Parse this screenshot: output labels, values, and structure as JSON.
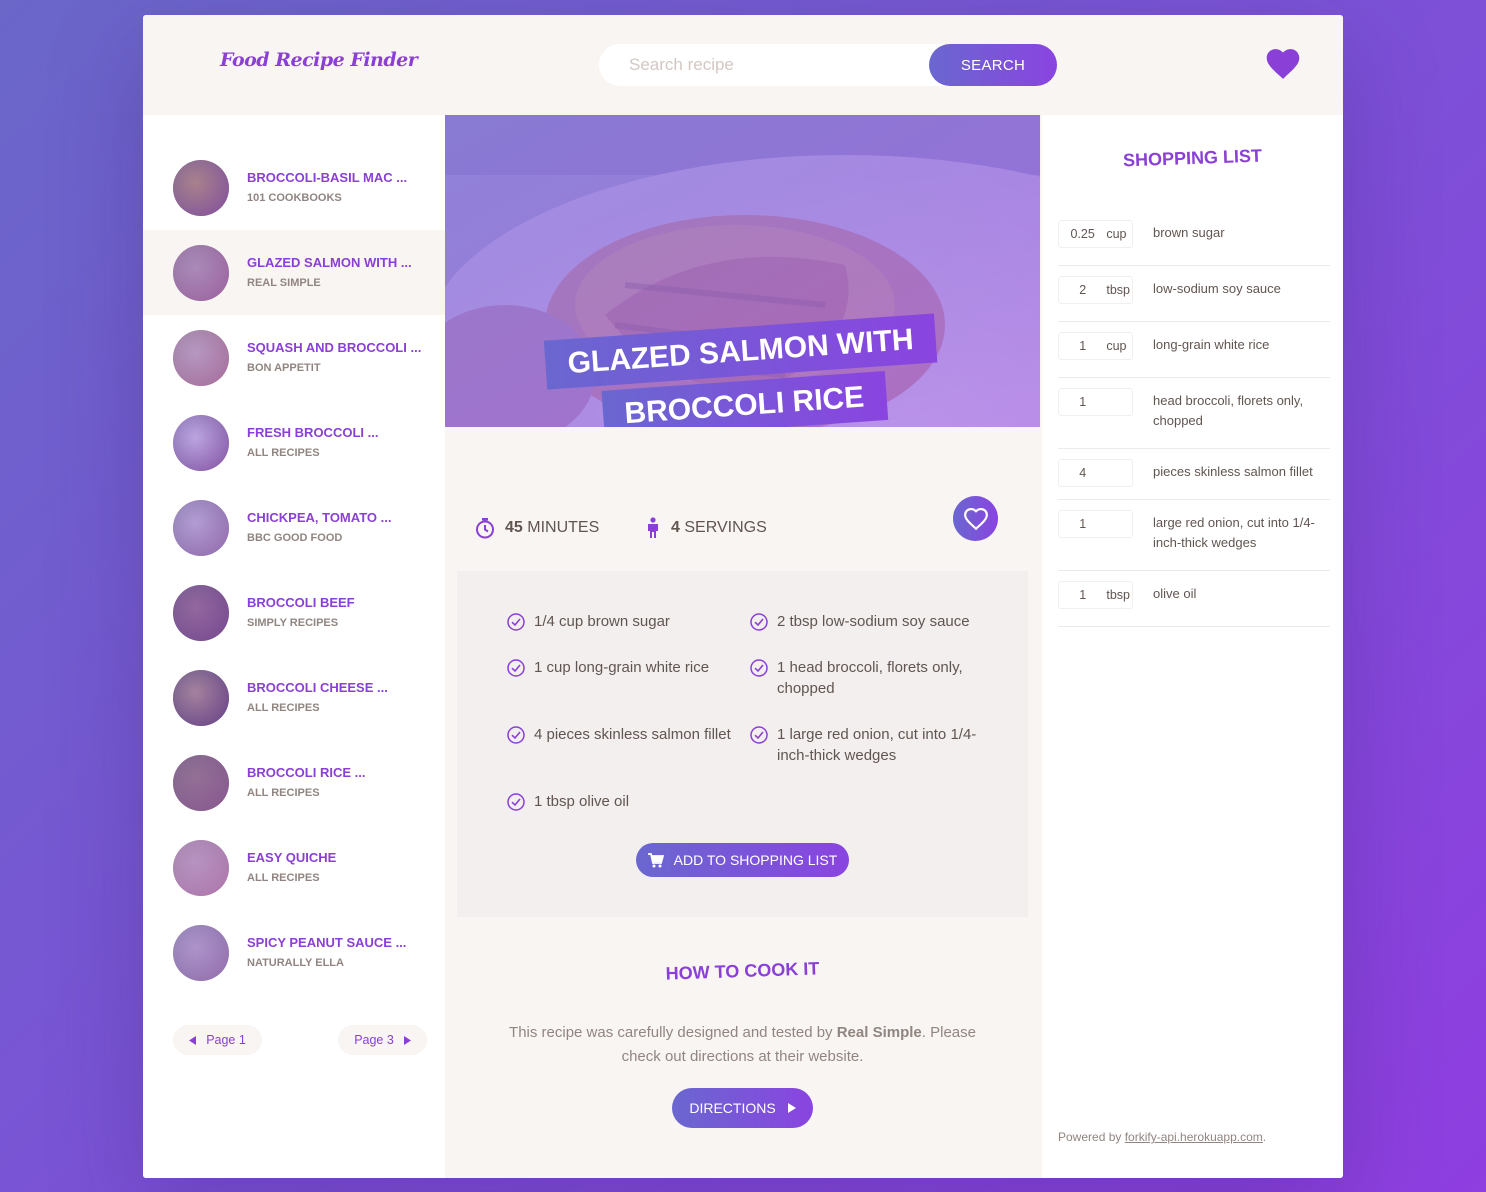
{
  "app": {
    "logo": "Food Recipe Finder"
  },
  "search": {
    "placeholder": "Search recipe",
    "button_label": "SEARCH"
  },
  "colors": {
    "accent": "#8a3fd6",
    "gradient_start": "#6a67d0",
    "gradient_end": "#8a44e0",
    "text": "#615551",
    "muted": "#918581",
    "panel": "#f9f5f3"
  },
  "results": [
    {
      "title": "Broccoli-Basil Mac ...",
      "author": "101 Cookbooks"
    },
    {
      "title": "Glazed Salmon with ...",
      "author": "Real Simple"
    },
    {
      "title": "Squash and Broccoli ...",
      "author": "Bon Appetit"
    },
    {
      "title": "Fresh Broccoli ...",
      "author": "All Recipes"
    },
    {
      "title": "Chickpea, Tomato ...",
      "author": "BBC Good Food"
    },
    {
      "title": "Broccoli Beef",
      "author": "Simply Recipes"
    },
    {
      "title": "Broccoli Cheese ...",
      "author": "All Recipes"
    },
    {
      "title": "Broccoli Rice ...",
      "author": "All Recipes"
    },
    {
      "title": "Easy Quiche",
      "author": "All Recipes"
    },
    {
      "title": "Spicy Peanut Sauce ...",
      "author": "Naturally Ella"
    }
  ],
  "pagination": {
    "prev_label": "Page 1",
    "next_label": "Page 3"
  },
  "recipe": {
    "title_line1": "Glazed Salmon with",
    "title_line2": "Broccoli Rice",
    "minutes": "45",
    "minutes_label": "minutes",
    "servings": "4",
    "servings_label": "servings",
    "ingredients": [
      {
        "text": "1/4 cup brown sugar"
      },
      {
        "text": "2 tbsp low-sodium soy sauce"
      },
      {
        "text": "1 cup long-grain white rice"
      },
      {
        "text": "1 head broccoli, florets only, chopped"
      },
      {
        "text": "4 pieces skinless salmon fillet"
      },
      {
        "text": "1 large red onion, cut into 1/4-inch-thick wedges"
      },
      {
        "text": "1 tbsp olive oil"
      }
    ],
    "add_to_list_label": "Add to shopping list",
    "directions_heading": "How to cook it",
    "directions_text_before": "This recipe was carefully designed and tested by ",
    "directions_publisher": "Real Simple",
    "directions_text_after": ". Please check out directions at their website.",
    "directions_button": "Directions"
  },
  "shopping": {
    "heading": "Shopping List",
    "items": [
      {
        "count": "0.25",
        "unit": "cup",
        "desc": "brown sugar"
      },
      {
        "count": "2",
        "unit": "tbsp",
        "desc": "low-sodium soy sauce"
      },
      {
        "count": "1",
        "unit": "cup",
        "desc": "long-grain white rice"
      },
      {
        "count": "1",
        "unit": "",
        "desc": "head broccoli, florets only, chopped"
      },
      {
        "count": "4",
        "unit": "",
        "desc": "pieces skinless salmon fillet"
      },
      {
        "count": "1",
        "unit": "",
        "desc": "large red onion, cut into 1/4-inch-thick wedges"
      },
      {
        "count": "1",
        "unit": "tbsp",
        "desc": "olive oil"
      }
    ]
  },
  "footer": {
    "powered_by": "Powered by ",
    "link_text": "forkify-api.herokuapp.com",
    "suffix": "."
  }
}
